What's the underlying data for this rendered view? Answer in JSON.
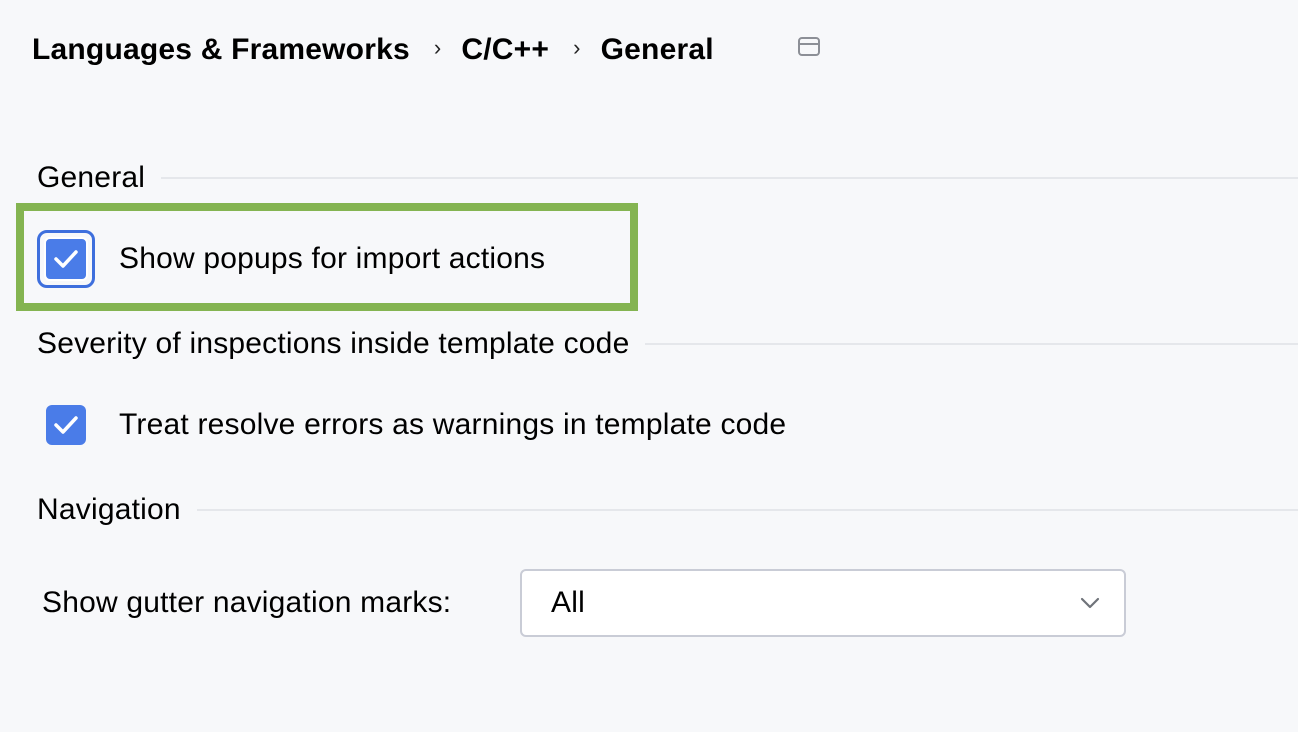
{
  "breadcrumb": {
    "items": [
      "Languages & Frameworks",
      "C/C++",
      "General"
    ],
    "separator": "›"
  },
  "sections": {
    "general": {
      "title": "General",
      "popups_checkbox": {
        "label": "Show popups for import actions",
        "checked": true,
        "focused": true
      }
    },
    "severity": {
      "title": "Severity of inspections inside template code",
      "resolve_checkbox": {
        "label": "Treat resolve errors as warnings in template code",
        "checked": true
      }
    },
    "navigation": {
      "title": "Navigation",
      "gutter": {
        "label": "Show gutter navigation marks:",
        "selected": "All"
      }
    }
  },
  "colors": {
    "accent": "#4a7ce8",
    "focus_ring": "#3e6fdd",
    "highlight": "#84b451",
    "background": "#f7f8fa"
  },
  "icons": {
    "window": "window-icon",
    "check": "checkmark-icon",
    "dropdown": "chevron-down-icon"
  }
}
